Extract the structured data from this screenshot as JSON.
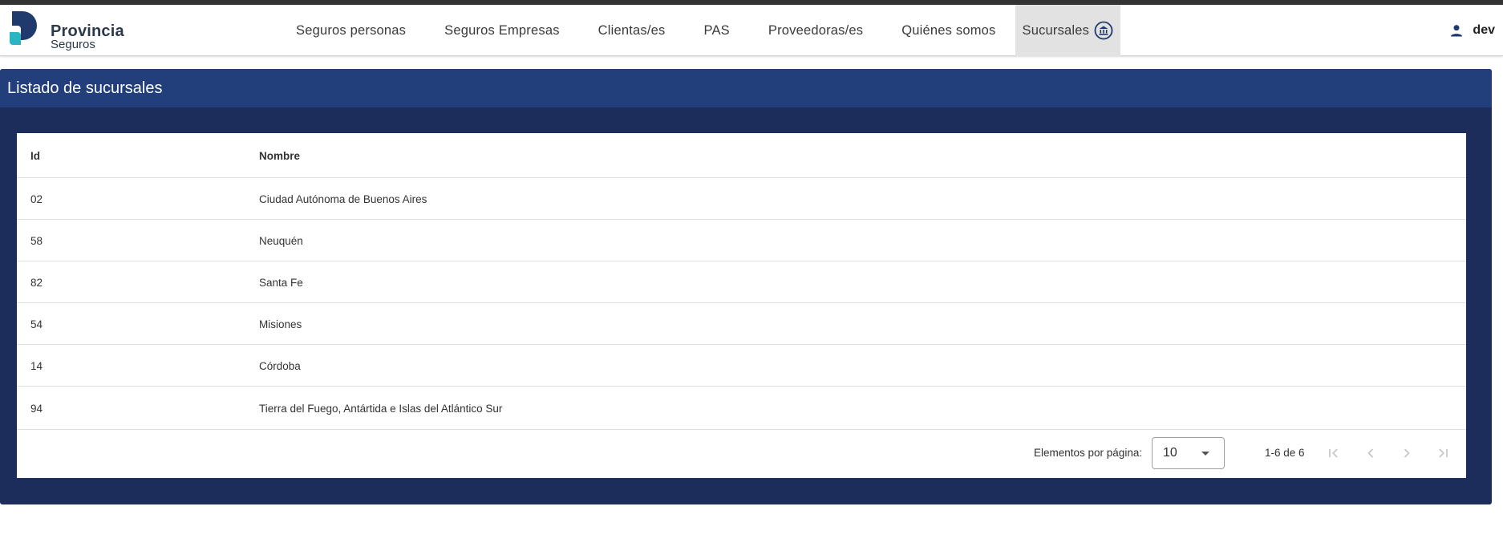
{
  "brand": {
    "name": "Provincia",
    "sub": "Seguros"
  },
  "nav": {
    "items": [
      "Seguros personas",
      "Seguros Empresas",
      "Clientas/es",
      "PAS",
      "Proveedoras/es",
      "Quiénes somos"
    ],
    "active": "Sucursales"
  },
  "user": {
    "name": "dev"
  },
  "panel": {
    "title": "Listado de sucursales"
  },
  "table": {
    "columns": [
      "Id",
      "Nombre"
    ],
    "rows": [
      {
        "id": "02",
        "name": "Ciudad Autónoma de Buenos Aires"
      },
      {
        "id": "58",
        "name": "Neuquén"
      },
      {
        "id": "82",
        "name": "Santa Fe"
      },
      {
        "id": "54",
        "name": "Misiones"
      },
      {
        "id": "14",
        "name": "Córdoba"
      },
      {
        "id": "94",
        "name": "Tierra del Fuego, Antártida e Islas del Atlántico Sur"
      }
    ]
  },
  "paginator": {
    "label": "Elementos por página:",
    "page_size": "10",
    "range": "1-6 de 6"
  },
  "icons": {
    "bank": "bank-icon",
    "user": "account-icon",
    "first": "first-page-icon",
    "prev": "chevron-left-icon",
    "next": "chevron-right-icon",
    "last": "last-page-icon"
  },
  "colors": {
    "panel": "#1c2c5b",
    "panel_header": "#233f7b",
    "brand_dark": "#213a6e",
    "brand_teal": "#2bb5c3"
  }
}
